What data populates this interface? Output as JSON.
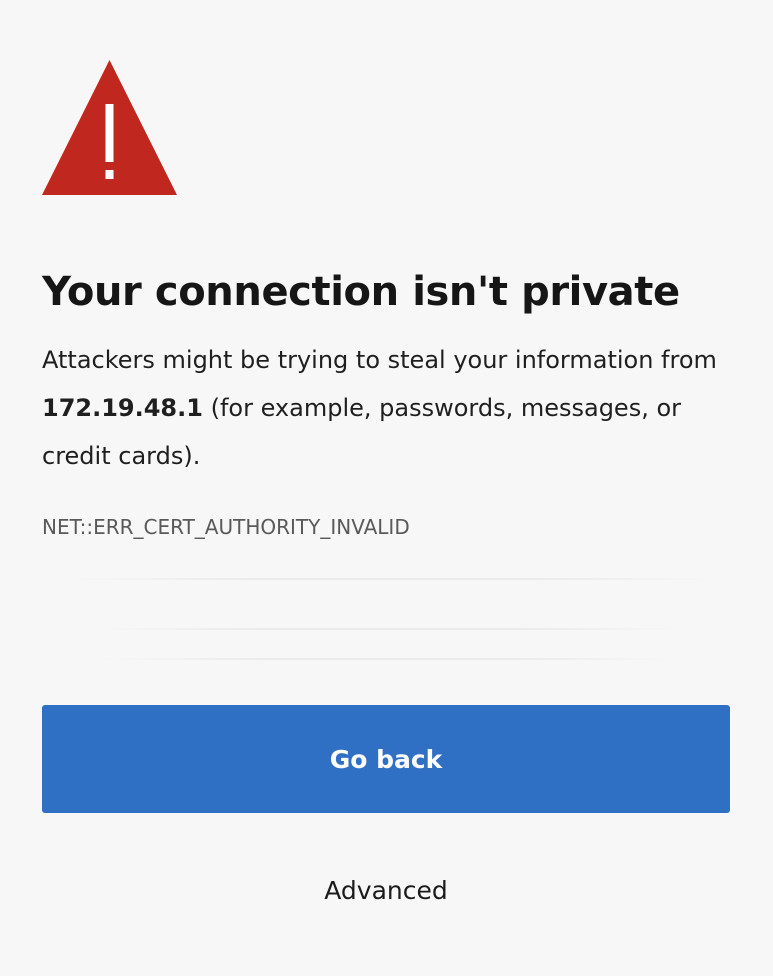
{
  "page": {
    "title": "Your connection isn't private",
    "message_prefix": "Attackers might be trying to steal your information from ",
    "host": "172.19.48.1",
    "message_suffix": " (for example, passwords, messages, or credit cards).",
    "error_code": "NET::ERR_CERT_AUTHORITY_INVALID"
  },
  "actions": {
    "go_back_label": "Go back",
    "advanced_label": "Advanced"
  },
  "icons": {
    "warning": "warning-triangle-icon"
  },
  "colors": {
    "background": "#f7f7f7",
    "warning_red": "#c0281f",
    "primary_button": "#2f6fc4",
    "error_code_text": "#595959"
  }
}
